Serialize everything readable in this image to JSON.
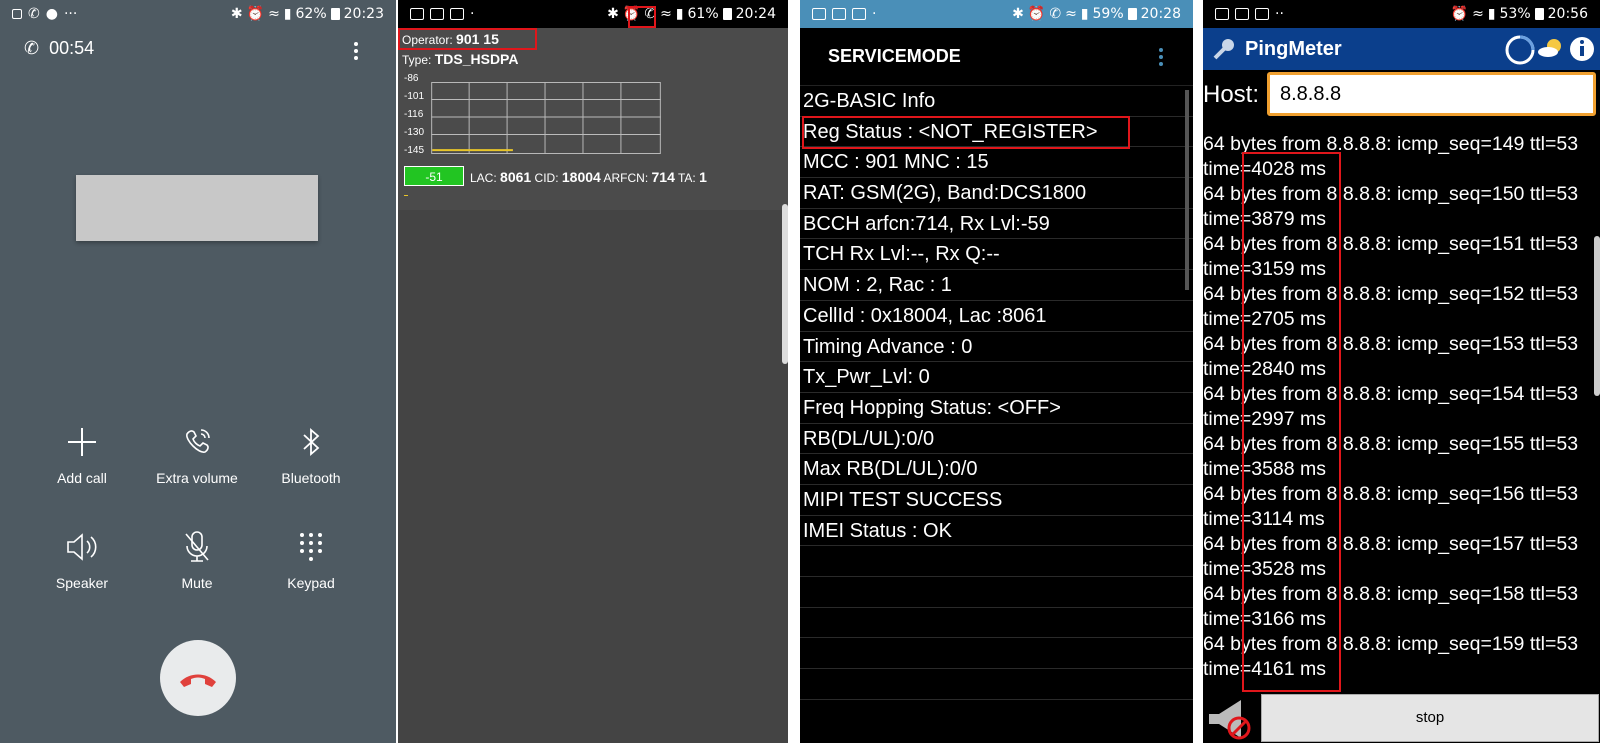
{
  "panel1": {
    "status": {
      "battery": "62%",
      "time": "20:23"
    },
    "call_timer": "00:54",
    "actions": [
      {
        "label": "Add call",
        "icon": "plus-icon"
      },
      {
        "label": "Extra volume",
        "icon": "extra-volume-icon"
      },
      {
        "label": "Bluetooth",
        "icon": "bluetooth-icon"
      },
      {
        "label": "Speaker",
        "icon": "speaker-icon"
      },
      {
        "label": "Mute",
        "icon": "mute-icon"
      },
      {
        "label": "Keypad",
        "icon": "keypad-icon"
      }
    ],
    "end_call_color": "#e0413c"
  },
  "panel2": {
    "status": {
      "battery": "61%",
      "time": "20:24"
    },
    "operator_label": "Operator:",
    "operator_value": "901 15",
    "type_label": "Type:",
    "type_value": "TDS_HSDPA",
    "y_ticks": [
      "-86",
      "-101",
      "-116",
      "-130",
      "-145"
    ],
    "signal": "-51",
    "lac_label": "LAC:",
    "lac_value": "8061",
    "cid_label": "CID:",
    "cid_value": "18004",
    "arfcn_label": "ARFCN:",
    "arfcn_value": "714",
    "ta_label": "TA:",
    "ta_value": "1",
    "signal_color": "#22c522"
  },
  "panel3": {
    "status": {
      "battery": "59%",
      "time": "20:28"
    },
    "title": "SERVICEMODE",
    "rows": [
      "2G-BASIC Info",
      "Reg Status : <NOT_REGISTER>",
      "MCC : 901 MNC : 15",
      "RAT: GSM(2G), Band:DCS1800",
      "BCCH arfcn:714, Rx Lvl:-59",
      "TCH Rx Lvl:--, Rx Q:--",
      "NOM : 2, Rac : 1",
      "CellId : 0x18004, Lac :8061",
      "Timing Advance : 0",
      "Tx_Pwr_Lvl: 0",
      "Freq Hopping Status: <OFF>",
      "RB(DL/UL):0/0",
      "Max RB(DL/UL):0/0",
      "MIPI TEST SUCCESS",
      "IMEI Status : OK"
    ]
  },
  "panel4": {
    "status": {
      "battery": "53%",
      "time": "20:56"
    },
    "app_title": "PingMeter",
    "host_label": "Host:",
    "host_value": "8.8.8.8",
    "log": [
      {
        "line1": "64 bytes from 8.8.8.8: icmp_seq=149 ttl=53",
        "line2": "time=4028 ms"
      },
      {
        "line1": "64 bytes from 8.8.8.8: icmp_seq=150 ttl=53",
        "line2": "time=3879 ms"
      },
      {
        "line1": "64 bytes from 8.8.8.8: icmp_seq=151 ttl=53",
        "line2": "time=3159 ms"
      },
      {
        "line1": "64 bytes from 8.8.8.8: icmp_seq=152 ttl=53",
        "line2": "time=2705 ms"
      },
      {
        "line1": "64 bytes from 8.8.8.8: icmp_seq=153 ttl=53",
        "line2": "time=2840 ms"
      },
      {
        "line1": "64 bytes from 8.8.8.8: icmp_seq=154 ttl=53",
        "line2": "time=2997 ms"
      },
      {
        "line1": "64 bytes from 8.8.8.8: icmp_seq=155 ttl=53",
        "line2": "time=3588 ms"
      },
      {
        "line1": "64 bytes from 8.8.8.8: icmp_seq=156 ttl=53",
        "line2": "time=3114 ms"
      },
      {
        "line1": "64 bytes from 8.8.8.8: icmp_seq=157 ttl=53",
        "line2": "time=3528 ms"
      },
      {
        "line1": "64 bytes from 8.8.8.8: icmp_seq=158 ttl=53",
        "line2": "time=3166 ms"
      },
      {
        "line1": "64 bytes from 8.8.8.8: icmp_seq=159 ttl=53",
        "line2": "time=4161 ms"
      }
    ],
    "stop_label": "stop",
    "titlebar_color": "#0b3f8c"
  }
}
